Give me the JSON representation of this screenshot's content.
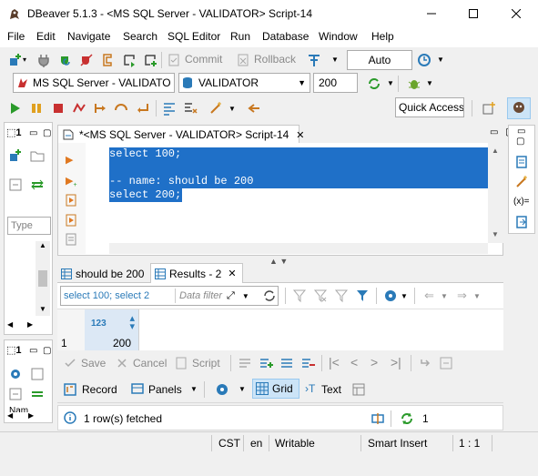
{
  "window": {
    "title": "DBeaver 5.1.3 - <MS SQL Server - VALIDATOR> Script-14"
  },
  "menu": [
    "File",
    "Edit",
    "Navigate",
    "Search",
    "SQL Editor",
    "Run",
    "Database",
    "Window",
    "Help"
  ],
  "toolbar1": {
    "commit_label": "Commit",
    "rollback_label": "Rollback",
    "auto_label": "Auto"
  },
  "toolbar2": {
    "connection": "MS SQL Server - VALIDATO",
    "database": "VALIDATOR",
    "limit": "200"
  },
  "quick_access": "Quick Access",
  "left_panel": {
    "tab_label": "1",
    "filter_placeholder": "Type",
    "bottom_tab_label": "1",
    "bottom_text": "Nam"
  },
  "editor": {
    "tab_title": "*<MS SQL Server - VALIDATOR> Script-14",
    "lines": [
      "select 100;",
      "",
      "-- name: should be 200",
      "select 200;"
    ]
  },
  "results": {
    "tabs": [
      "should be 200",
      "Results - 2"
    ],
    "filter_query": "select 100; select 2",
    "filter_placeholder": "Data filter",
    "column_type": "123",
    "rows": [
      {
        "num": "1",
        "value": "200"
      }
    ],
    "bottom_buttons": {
      "save": "Save",
      "cancel": "Cancel",
      "script": "Script"
    },
    "record_label": "Record",
    "panels_label": "Panels",
    "grid_label": "Grid",
    "text_label": "Text",
    "status": "1 row(s) fetched",
    "refresh_count": "1"
  },
  "right_panel": {
    "formula_label": "(x)="
  },
  "statusbar": {
    "timezone": "CST",
    "locale": "en",
    "mode": "Writable",
    "insert_mode": "Smart Insert",
    "position": "1 : 1"
  }
}
